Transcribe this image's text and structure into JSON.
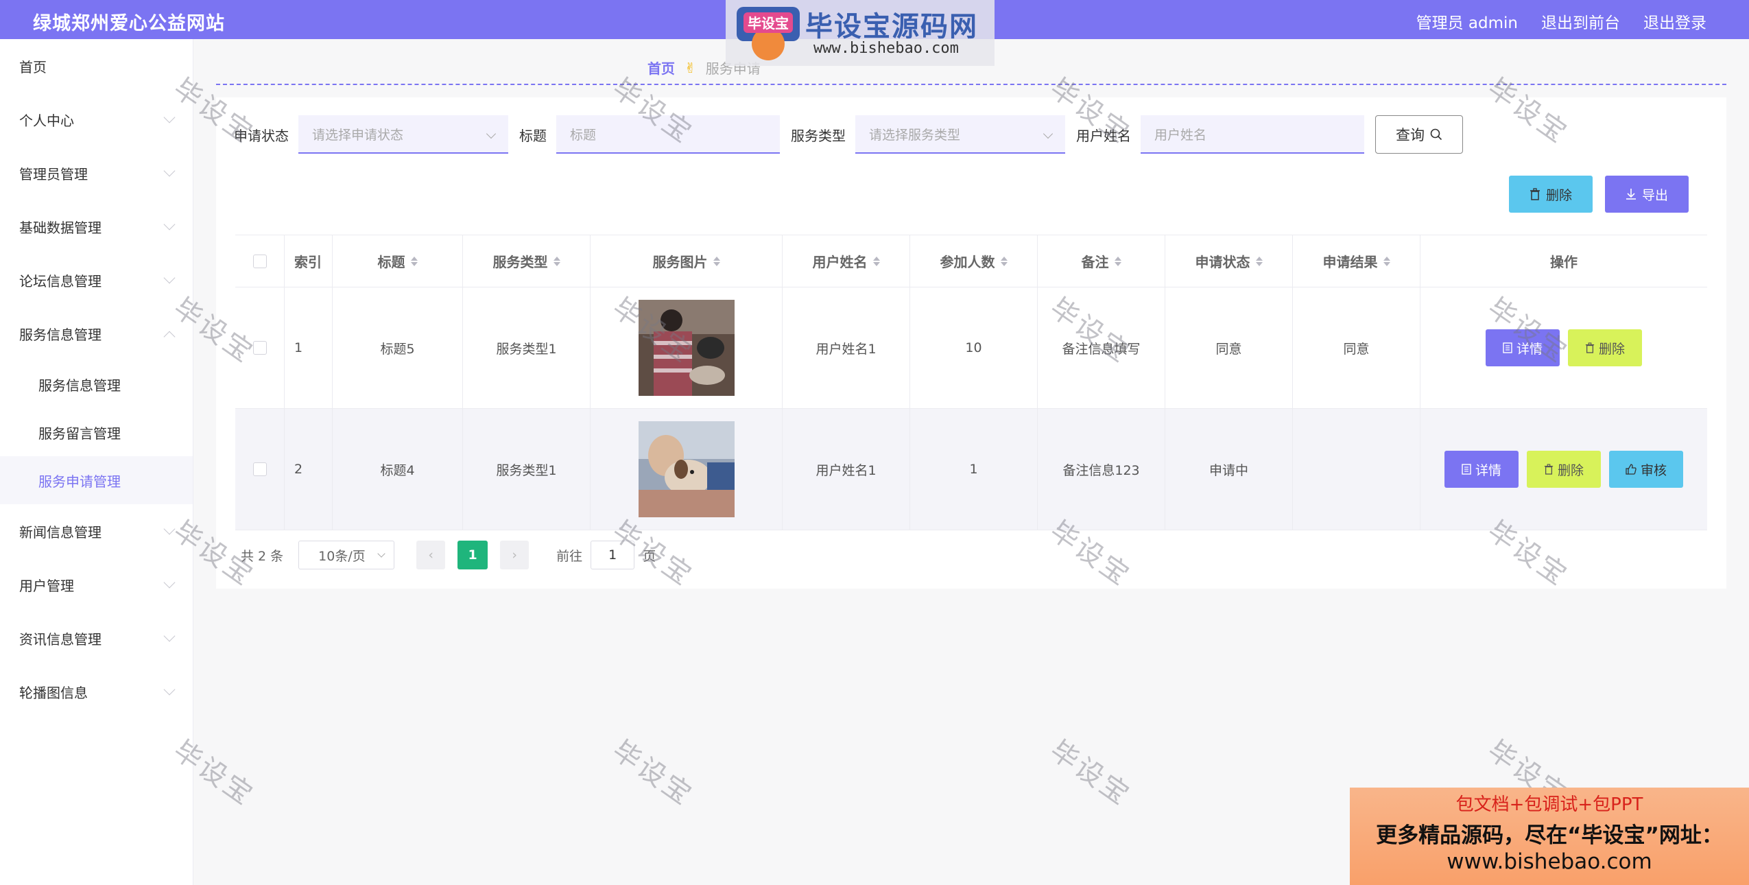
{
  "header": {
    "brand": "绿城郑州爱心公益网站",
    "admin_label": "管理员 admin",
    "to_front": "退出到前台",
    "logout": "退出登录"
  },
  "sidebar": {
    "items": [
      {
        "label": "首页"
      },
      {
        "label": "个人中心"
      },
      {
        "label": "管理员管理"
      },
      {
        "label": "基础数据管理"
      },
      {
        "label": "论坛信息管理"
      },
      {
        "label": "服务信息管理"
      },
      {
        "label": "新闻信息管理"
      },
      {
        "label": "用户管理"
      },
      {
        "label": "资讯信息管理"
      },
      {
        "label": "轮播图信息"
      }
    ],
    "sub_items": [
      {
        "label": "服务信息管理"
      },
      {
        "label": "服务留言管理"
      },
      {
        "label": "服务申请管理"
      }
    ]
  },
  "breadcrumb": {
    "home": "首页",
    "sep": "✌",
    "current": "服务申请"
  },
  "search": {
    "status_label": "申请状态",
    "status_placeholder": "请选择申请状态",
    "title_label": "标题",
    "title_placeholder": "标题",
    "type_label": "服务类型",
    "type_placeholder": "请选择服务类型",
    "user_label": "用户姓名",
    "user_placeholder": "用户姓名",
    "query_label": "查询"
  },
  "toolbar": {
    "delete_label": "删除",
    "export_label": "导出"
  },
  "table": {
    "headers": {
      "index": "索引",
      "title": "标题",
      "type": "服务类型",
      "image": "服务图片",
      "user": "用户姓名",
      "count": "参加人数",
      "note": "备注",
      "status": "申请状态",
      "result": "申请结果",
      "ops": "操作"
    },
    "rows": [
      {
        "index": "1",
        "title": "标题5",
        "type": "服务类型1",
        "user": "用户姓名1",
        "count": "10",
        "note": "备注信息填写",
        "status": "同意",
        "result": "同意"
      },
      {
        "index": "2",
        "title": "标题4",
        "type": "服务类型1",
        "user": "用户姓名1",
        "count": "1",
        "note": "备注信息123",
        "status": "申请中",
        "result": ""
      }
    ],
    "op_labels": {
      "detail": "详情",
      "delete": "删除",
      "audit": "审核"
    }
  },
  "pagination": {
    "total": "共 2 条",
    "page_size": "10条/页",
    "current_page": "1",
    "goto_label": "前往",
    "goto_value": "1",
    "page_suffix": "页"
  },
  "watermarks": {
    "text": "毕设宝",
    "logo_badge": "毕设宝",
    "logo_title": "毕设宝源码网",
    "logo_url": "www.bishebao.com",
    "ad_line1": "包文档+包调试+包PPT",
    "ad_line2": "更多精品源码，尽在“毕设宝”网址：",
    "ad_line3": "www.bishebao.com"
  },
  "colors": {
    "primary": "#7b74f2",
    "cyan": "#5bc7ee",
    "lime": "#d8f25a",
    "green": "#1fb57c"
  }
}
